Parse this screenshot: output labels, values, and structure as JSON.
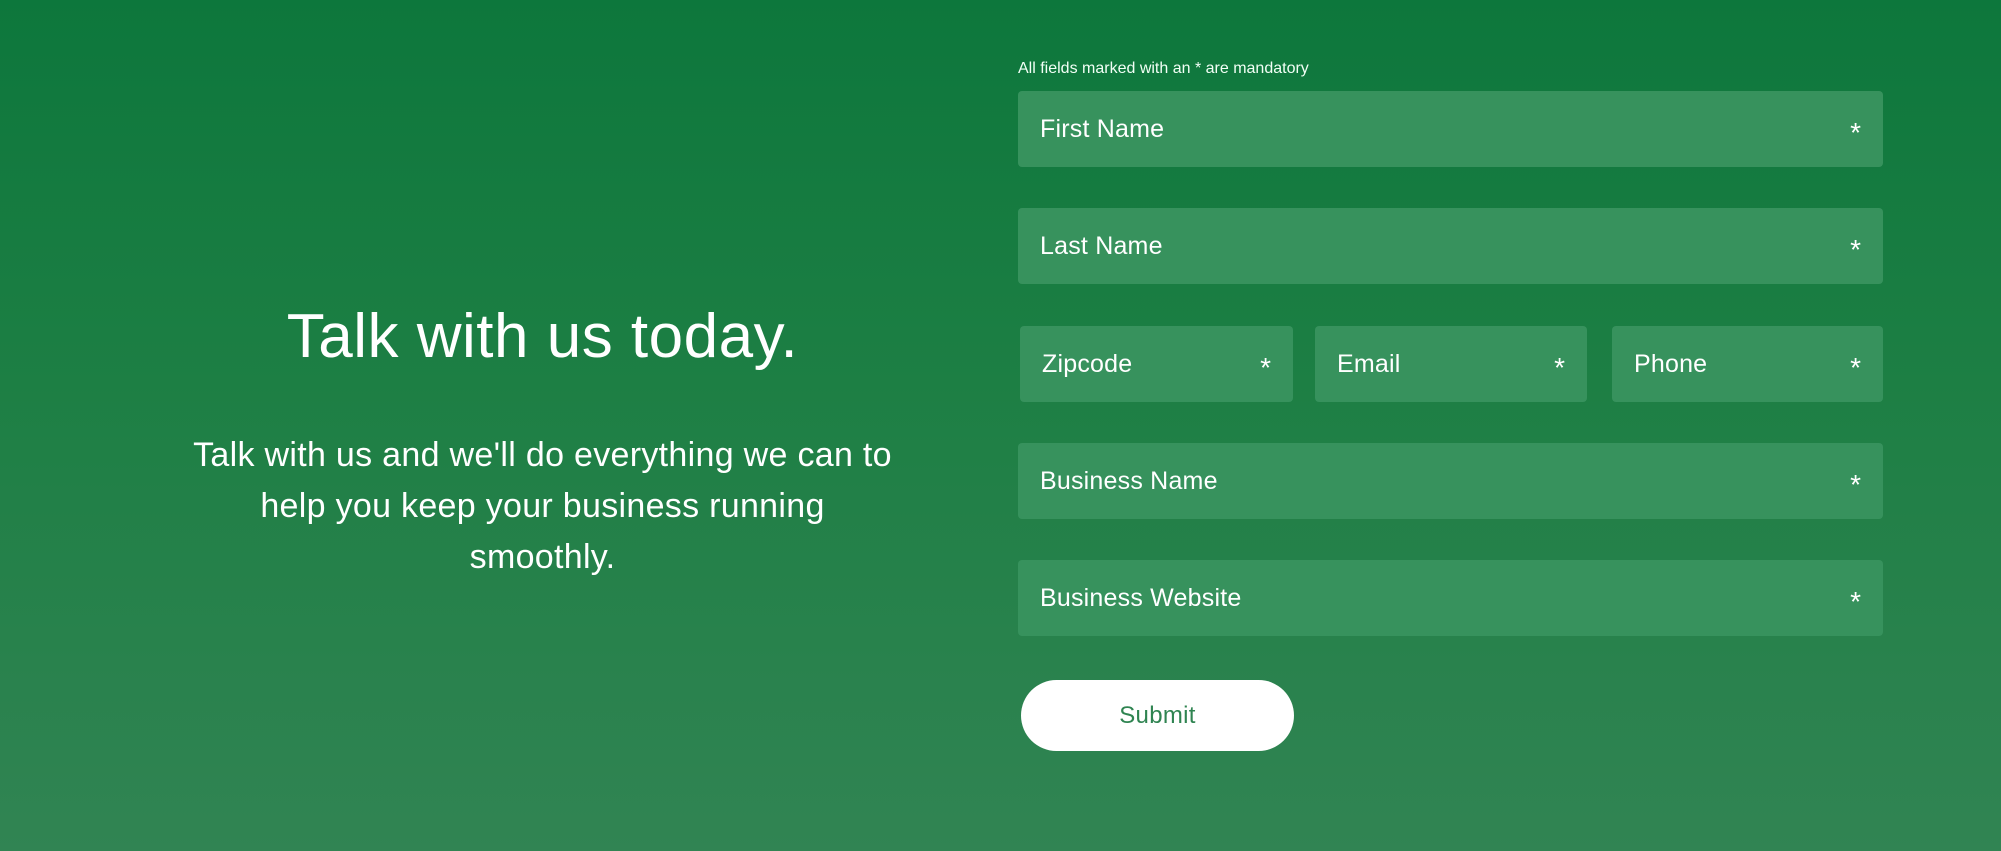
{
  "hero": {
    "title": "Talk with us today.",
    "subtitle": "Talk with us and we'll do everything we can to help you keep your business running smoothly."
  },
  "form": {
    "mandatory_note": "All fields marked with an * are mandatory",
    "required_marker": "*",
    "fields": {
      "first_name": {
        "label": "First Name",
        "value": ""
      },
      "last_name": {
        "label": "Last Name",
        "value": ""
      },
      "zipcode": {
        "label": "Zipcode",
        "value": ""
      },
      "email": {
        "label": "Email",
        "value": ""
      },
      "phone": {
        "label": "Phone",
        "value": ""
      },
      "business_name": {
        "label": "Business Name",
        "value": ""
      },
      "business_website": {
        "label": "Business Website",
        "value": ""
      }
    },
    "submit_label": "Submit"
  },
  "colors": {
    "background_top": "#0d773c",
    "background_bottom": "#318453",
    "field_background": "#37925d",
    "button_background": "#ffffff",
    "button_text": "#2f8451"
  }
}
